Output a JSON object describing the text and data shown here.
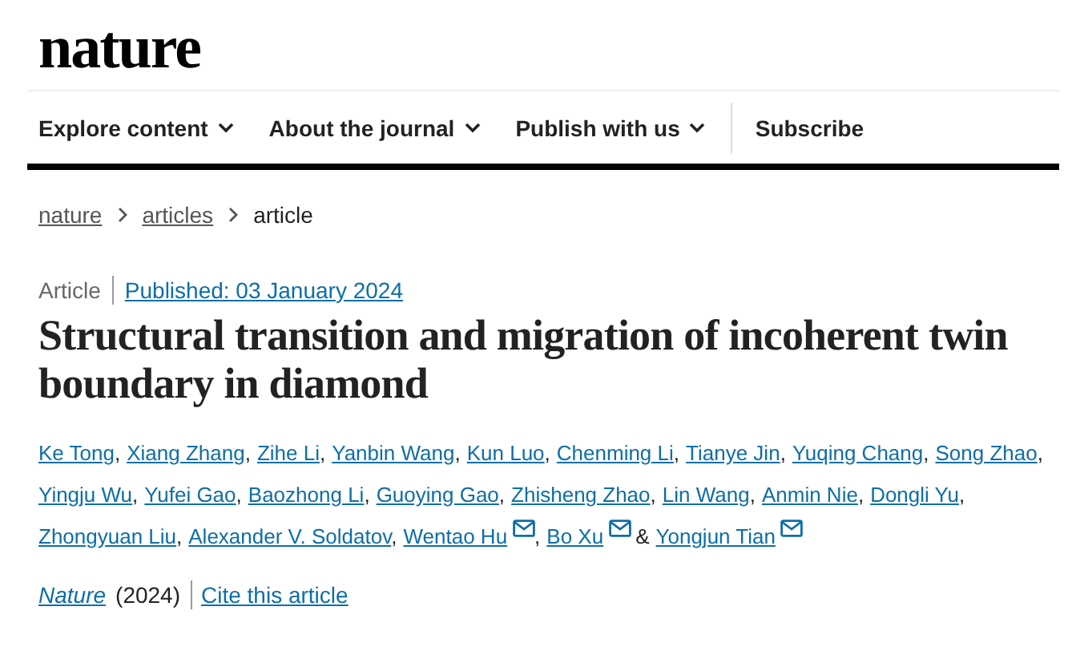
{
  "logo": "nature",
  "nav": [
    {
      "label": "Explore content",
      "kind": "menu"
    },
    {
      "label": "About the journal",
      "kind": "menu"
    },
    {
      "label": "Publish with us",
      "kind": "menu"
    },
    {
      "label": "Subscribe",
      "kind": "link"
    }
  ],
  "breadcrumb": [
    {
      "label": "nature",
      "current": false
    },
    {
      "label": "articles",
      "current": false
    },
    {
      "label": "article",
      "current": true
    }
  ],
  "article_type": "Article",
  "published": "Published: 03 January 2024",
  "title": "Structural transition and migration of incoherent twin boundary in diamond",
  "authors": [
    {
      "name": "Ke Tong",
      "email": false,
      "suffix": ","
    },
    {
      "name": "Xiang Zhang",
      "email": false,
      "suffix": ","
    },
    {
      "name": "Zihe Li",
      "email": false,
      "suffix": ","
    },
    {
      "name": "Yanbin Wang",
      "email": false,
      "suffix": ","
    },
    {
      "name": "Kun Luo",
      "email": false,
      "suffix": ","
    },
    {
      "name": "Chenming Li",
      "email": false,
      "suffix": ","
    },
    {
      "name": "Tianye Jin",
      "email": false,
      "suffix": ","
    },
    {
      "name": "Yuqing Chang",
      "email": false,
      "suffix": ","
    },
    {
      "name": "Song Zhao",
      "email": false,
      "suffix": ","
    },
    {
      "name": "Yingju Wu",
      "email": false,
      "suffix": ","
    },
    {
      "name": "Yufei Gao",
      "email": false,
      "suffix": ","
    },
    {
      "name": "Baozhong Li",
      "email": false,
      "suffix": ","
    },
    {
      "name": "Guoying Gao",
      "email": false,
      "suffix": ","
    },
    {
      "name": "Zhisheng Zhao",
      "email": false,
      "suffix": ","
    },
    {
      "name": "Lin Wang",
      "email": false,
      "suffix": ","
    },
    {
      "name": "Anmin Nie",
      "email": false,
      "suffix": ","
    },
    {
      "name": "Dongli Yu",
      "email": false,
      "suffix": ","
    },
    {
      "name": "Zhongyuan Liu",
      "email": false,
      "suffix": ","
    },
    {
      "name": "Alexander V. Soldatov",
      "email": false,
      "suffix": ","
    },
    {
      "name": "Wentao Hu",
      "email": true,
      "suffix": ","
    },
    {
      "name": "Bo Xu",
      "email": true,
      "suffix": "&"
    },
    {
      "name": "Yongjun Tian",
      "email": true
    }
  ],
  "journal": "Nature",
  "year": "(2024)",
  "cite": "Cite this article"
}
